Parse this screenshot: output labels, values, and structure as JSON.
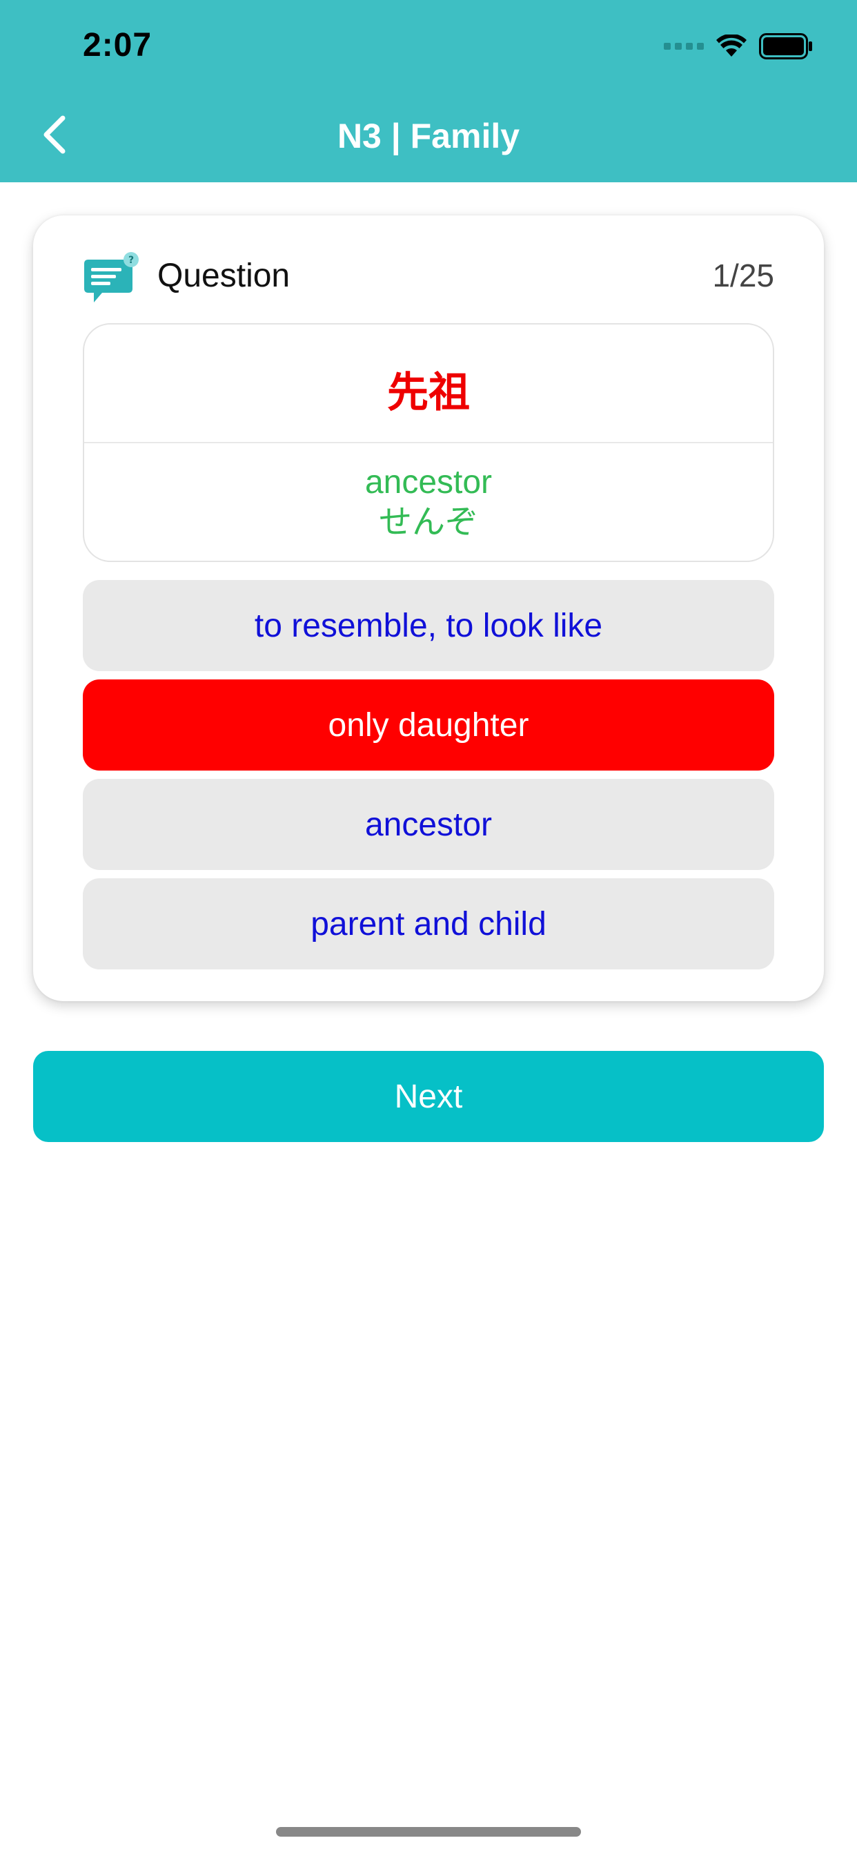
{
  "status_bar": {
    "time": "2:07"
  },
  "header": {
    "title": "N3 | Family"
  },
  "question": {
    "label": "Question",
    "counter": "1/25",
    "kanji": "先祖",
    "meaning": "ancestor",
    "reading": "せんぞ"
  },
  "answers": [
    {
      "label": "to resemble, to look like",
      "state": "default"
    },
    {
      "label": "only daughter",
      "state": "wrong"
    },
    {
      "label": "ancestor",
      "state": "default"
    },
    {
      "label": "parent and child",
      "state": "default"
    }
  ],
  "next_button": {
    "label": "Next"
  },
  "colors": {
    "header": "#3ebfc3",
    "accent": "#06c0c7",
    "wrong": "#ff0000",
    "kanji": "#ee0000",
    "correct_text": "#33bb55",
    "answer_text": "#1010d8"
  }
}
